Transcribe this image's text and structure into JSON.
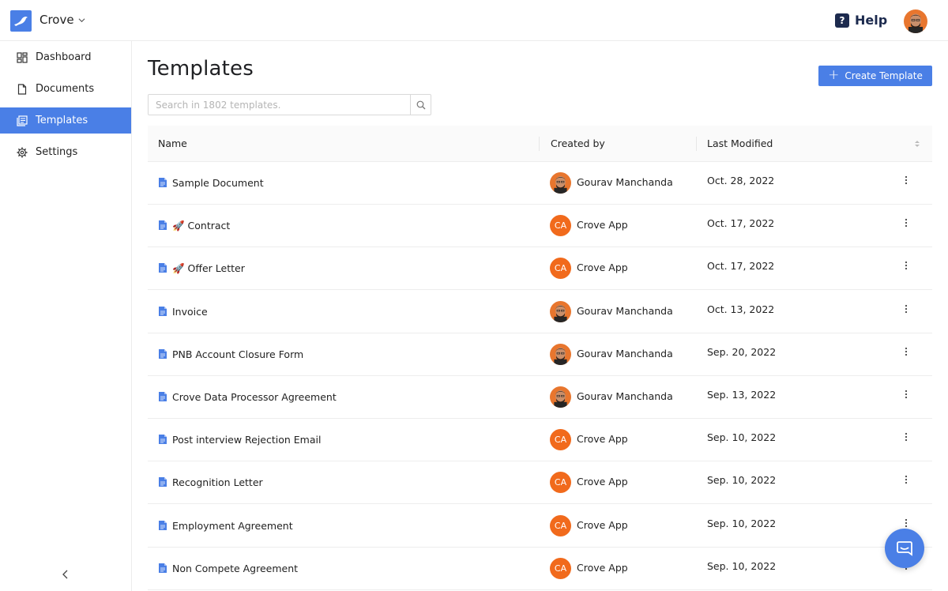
{
  "header": {
    "brand": "Crove",
    "help_label": "Help"
  },
  "sidebar": {
    "items": [
      {
        "label": "Dashboard",
        "icon": "dashboard-icon"
      },
      {
        "label": "Documents",
        "icon": "document-icon"
      },
      {
        "label": "Templates",
        "icon": "templates-icon",
        "active": true
      },
      {
        "label": "Settings",
        "icon": "gear-icon"
      }
    ]
  },
  "main": {
    "title": "Templates",
    "create_label": "Create Template",
    "search_placeholder": "Search in 1802 templates."
  },
  "table": {
    "columns": [
      "Name",
      "Created by",
      "Last Modified"
    ],
    "rows": [
      {
        "name": "Sample Document",
        "creator": "Gourav Manchanda",
        "creator_type": "photo",
        "modified": "Oct. 28, 2022"
      },
      {
        "name": "🚀 Contract",
        "creator": "Crove App",
        "creator_type": "initials",
        "initials": "CA",
        "modified": "Oct. 17, 2022"
      },
      {
        "name": "🚀 Offer Letter",
        "creator": "Crove App",
        "creator_type": "initials",
        "initials": "CA",
        "modified": "Oct. 17, 2022"
      },
      {
        "name": "Invoice",
        "creator": "Gourav Manchanda",
        "creator_type": "photo",
        "modified": "Oct. 13, 2022"
      },
      {
        "name": "PNB Account Closure Form",
        "creator": "Gourav Manchanda",
        "creator_type": "photo",
        "modified": "Sep. 20, 2022"
      },
      {
        "name": "Crove Data Processor Agreement",
        "creator": "Gourav Manchanda",
        "creator_type": "photo",
        "modified": "Sep. 13, 2022"
      },
      {
        "name": "Post interview Rejection Email",
        "creator": "Crove App",
        "creator_type": "initials",
        "initials": "CA",
        "modified": "Sep. 10, 2022"
      },
      {
        "name": "Recognition Letter",
        "creator": "Crove App",
        "creator_type": "initials",
        "initials": "CA",
        "modified": "Sep. 10, 2022"
      },
      {
        "name": "Employment Agreement",
        "creator": "Crove App",
        "creator_type": "initials",
        "initials": "CA",
        "modified": "Sep. 10, 2022"
      },
      {
        "name": "Non Compete Agreement",
        "creator": "Crove App",
        "creator_type": "initials",
        "initials": "CA",
        "modified": "Sep. 10, 2022"
      }
    ]
  },
  "colors": {
    "accent": "#4a7fe6",
    "initials_avatar": "#f16a1c",
    "help_navy": "#1c2a4e"
  }
}
